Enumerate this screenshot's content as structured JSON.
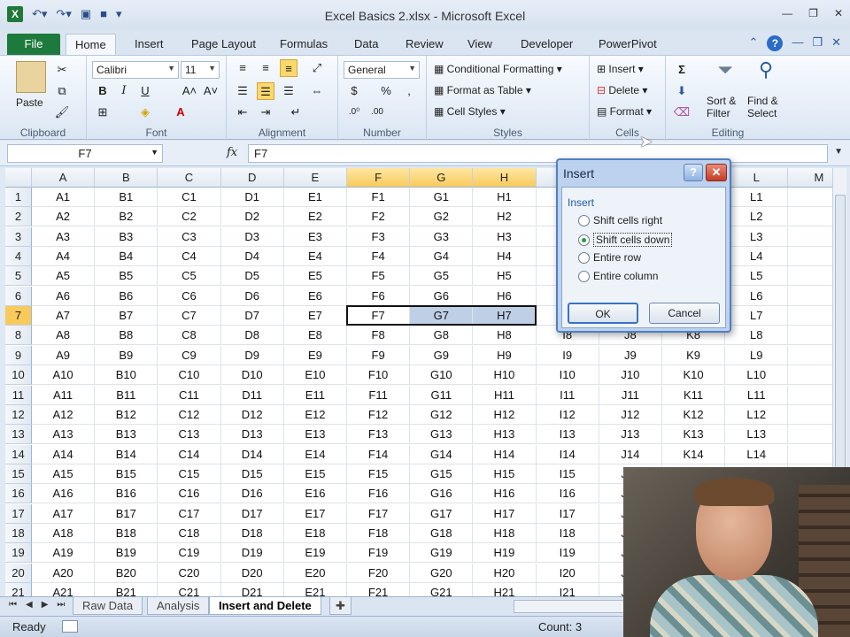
{
  "window": {
    "title": "Excel Basics 2.xlsx - Microsoft Excel",
    "app_icon": "X",
    "controls": [
      "minimize",
      "restore",
      "close"
    ]
  },
  "ribbon_tabs": [
    "File",
    "Home",
    "Insert",
    "Page Layout",
    "Formulas",
    "Data",
    "Review",
    "View",
    "Developer",
    "PowerPivot"
  ],
  "active_tab": "Home",
  "ribbon": {
    "clipboard": {
      "label": "Clipboard",
      "paste": "Paste"
    },
    "font": {
      "label": "Font",
      "name": "Calibri",
      "size": "11"
    },
    "alignment": {
      "label": "Alignment"
    },
    "number": {
      "label": "Number",
      "format": "General",
      "currency": "$",
      "percent": "%",
      "comma": ","
    },
    "styles": {
      "label": "Styles",
      "conditional": "Conditional Formatting",
      "format_table": "Format as Table",
      "cell_styles": "Cell Styles"
    },
    "cells": {
      "label": "Cells",
      "insert": "Insert",
      "delete": "Delete",
      "format": "Format"
    },
    "editing": {
      "label": "Editing",
      "sigma": "Σ",
      "sort": "Sort &",
      "filter": "Filter",
      "find": "Find &",
      "select": "Select"
    }
  },
  "formula_bar": {
    "name_box": "F7",
    "fx": "fx",
    "content": "F7"
  },
  "grid": {
    "columns": [
      "A",
      "B",
      "C",
      "D",
      "E",
      "F",
      "G",
      "H",
      "I",
      "J",
      "K",
      "L",
      "M"
    ],
    "highlighted_columns": [
      "F",
      "G",
      "H"
    ],
    "rows": 21,
    "selected_row": 7
  },
  "sheets": [
    "Raw Data",
    "Analysis",
    "Insert and Delete"
  ],
  "active_sheet": "Insert and Delete",
  "status": {
    "ready": "Ready",
    "count": "Count: 3"
  },
  "dialog": {
    "title": "Insert",
    "help": "?",
    "close": "✕",
    "group_label": "Insert",
    "options": [
      "Shift cells right",
      "Shift cells down",
      "Entire row",
      "Entire column"
    ],
    "selected_option": "Shift cells down",
    "ok": "OK",
    "cancel": "Cancel"
  },
  "colors": {
    "accent": "#1e7a3c",
    "header_highlight": "#f8ca5c",
    "selection": "#bfcfe6"
  }
}
